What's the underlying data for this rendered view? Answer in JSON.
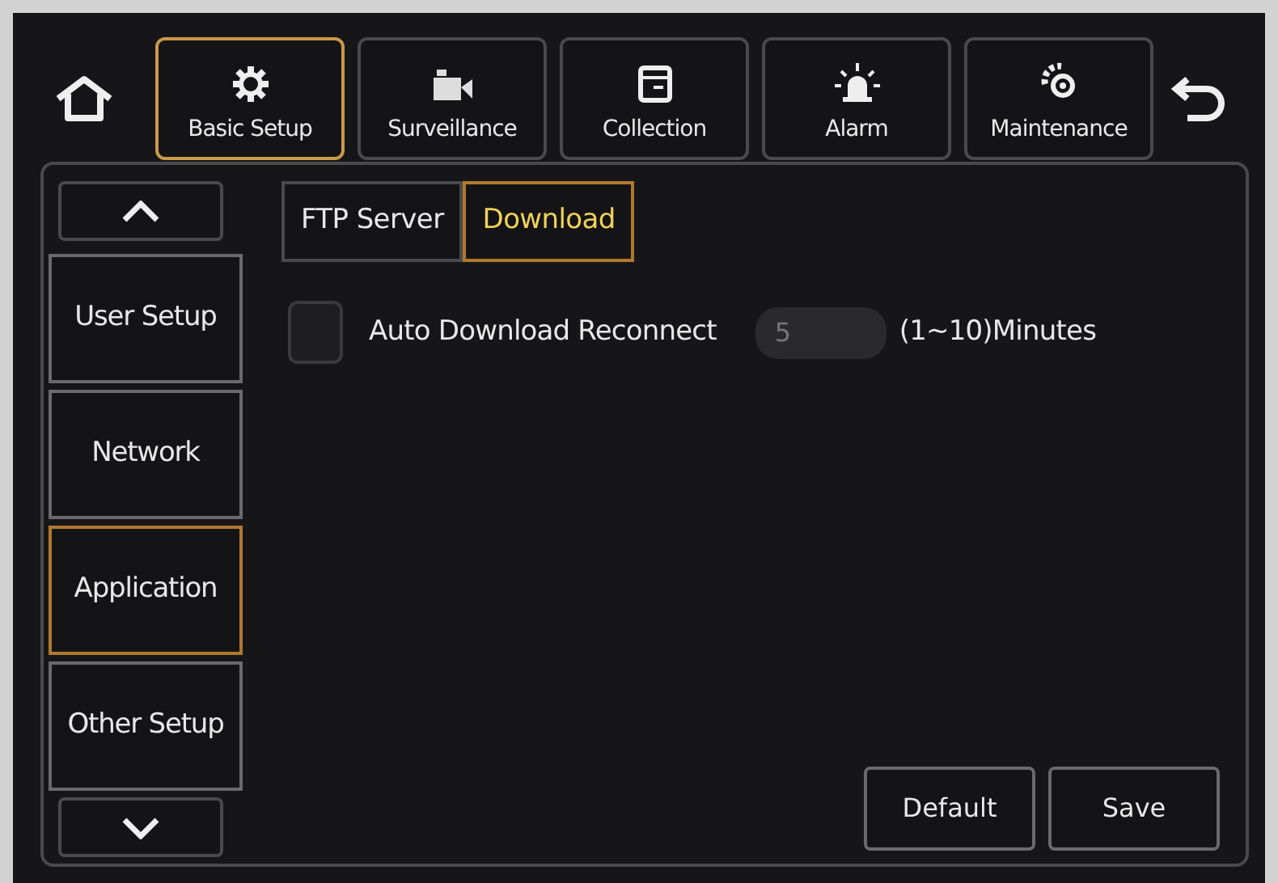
{
  "top_tabs": [
    {
      "label": "Basic Setup",
      "kind": "gear",
      "selected": true
    },
    {
      "label": "Surveillance",
      "kind": "camera",
      "selected": false
    },
    {
      "label": "Collection",
      "kind": "panel",
      "selected": false
    },
    {
      "label": "Alarm",
      "kind": "siren",
      "selected": false
    },
    {
      "label": "Maintenance",
      "kind": "gears",
      "selected": false
    }
  ],
  "sidebar": {
    "items": [
      {
        "label": "User Setup",
        "selected": false
      },
      {
        "label": "Network",
        "selected": false
      },
      {
        "label": "Application",
        "selected": true
      },
      {
        "label": "Other Setup",
        "selected": false
      }
    ]
  },
  "sub_tabs": [
    {
      "label": "FTP Server",
      "selected": false
    },
    {
      "label": "Download",
      "selected": true
    }
  ],
  "settings": [
    {
      "label": "Auto Download Reconnect",
      "checked": false,
      "value": "5",
      "disabled": true,
      "hint": "(1~10)Minutes"
    }
  ],
  "buttons": [
    "Default",
    "Save"
  ]
}
